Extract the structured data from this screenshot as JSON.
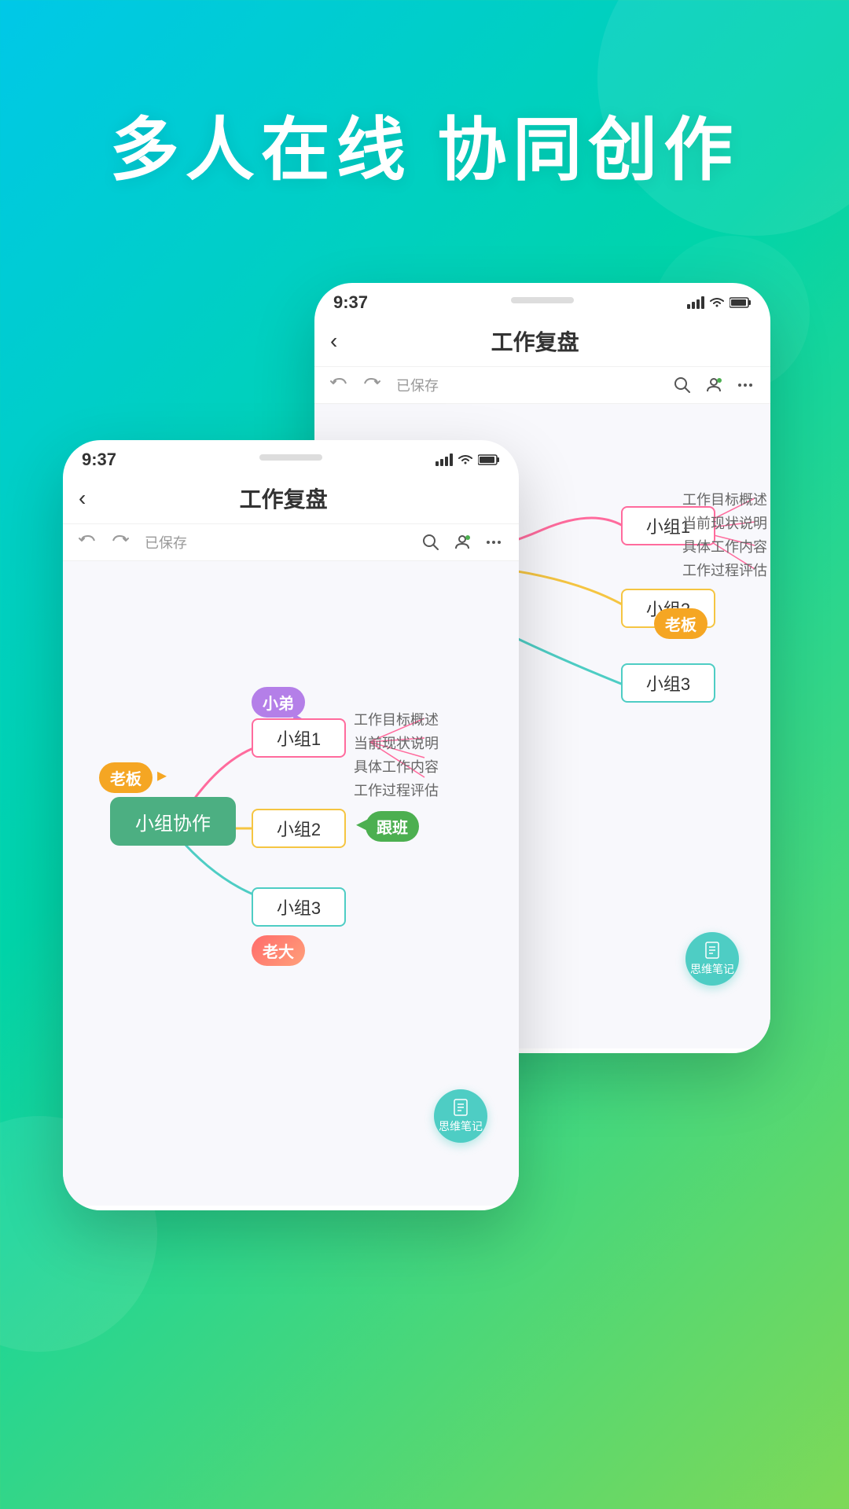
{
  "background": {
    "gradient_start": "#00c8e8",
    "gradient_mid": "#00d4aa",
    "gradient_end": "#7ed957"
  },
  "hero": {
    "title": "多人在线 协同创作"
  },
  "phone_back": {
    "time": "9:37",
    "title": "工作复盘",
    "saved_label": "已保存",
    "nodes": {
      "group1": "小组1",
      "group2": "小组2",
      "group3": "小组3",
      "boss_badge": "老板",
      "branches": [
        "工作目标概述",
        "当前现状说明",
        "具体工作内容",
        "工作过程评估"
      ]
    },
    "memo_label": "思维笔记"
  },
  "phone_front": {
    "time": "9:37",
    "title": "工作复盘",
    "saved_label": "已保存",
    "nodes": {
      "central": "小组协作",
      "group1": "小组1",
      "group2": "小组2",
      "group3": "小组3",
      "badge_xiaodi": "小弟",
      "badge_laoban": "老板",
      "badge_genban": "跟班",
      "badge_laoda": "老大",
      "branches": [
        "工作目标概述",
        "当前现状说明",
        "具体工作内容",
        "工作过程评估"
      ]
    },
    "memo_label": "思维笔记"
  }
}
